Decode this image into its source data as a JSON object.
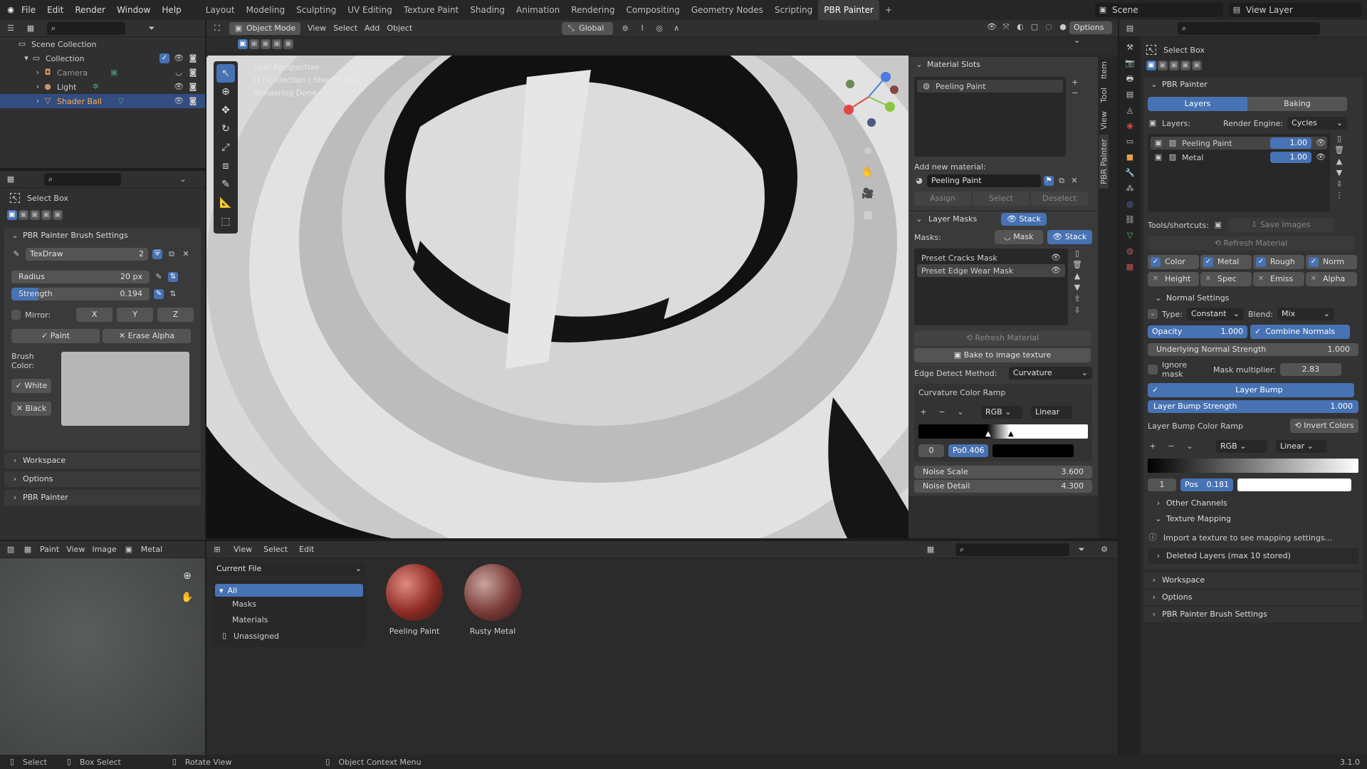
{
  "topmenu": [
    "File",
    "Edit",
    "Render",
    "Window",
    "Help"
  ],
  "workspaces": [
    "Layout",
    "Modeling",
    "Sculpting",
    "UV Editing",
    "Texture Paint",
    "Shading",
    "Animation",
    "Rendering",
    "Compositing",
    "Geometry Nodes",
    "Scripting",
    "PBR Painter"
  ],
  "active_workspace": "PBR Painter",
  "scene_name": "Scene",
  "view_layer": "View Layer",
  "outliner": {
    "root": "Scene Collection",
    "collection": "Collection",
    "items": [
      "Camera",
      "Light",
      "Shader Ball"
    ]
  },
  "left_tool": {
    "title": "Select Box",
    "brush_panel": "PBR Painter Brush Settings",
    "brush_name": "TexDraw",
    "brush_users": "2",
    "radius_label": "Radius",
    "radius_value": "20 px",
    "strength_label": "Strength",
    "strength_value": "0.194",
    "mirror_label": "Mirror:",
    "mirror_axes": [
      "X",
      "Y",
      "Z"
    ],
    "paint_btn": "Paint",
    "erase_btn": "Erase Alpha",
    "brush_color_label": "Brush Color:",
    "white_btn": "White",
    "black_btn": "Black",
    "sections": [
      "Workspace",
      "Options",
      "PBR Painter"
    ]
  },
  "viewport": {
    "mode": "Object Mode",
    "menus": [
      "View",
      "Select",
      "Add",
      "Object"
    ],
    "orientation": "Global",
    "options": "Options",
    "overlay_lines": [
      "User Perspective",
      "(1) Collection | Shader Ball",
      "Rendering Done"
    ]
  },
  "npanel": {
    "tabs": [
      "Item",
      "Tool",
      "View",
      "PBR Painter"
    ],
    "material_slots_title": "Material Slots",
    "slot": "Peeling Paint",
    "add_new_material": "Add new material:",
    "new_material": "Peeling Paint",
    "assign": "Assign",
    "select": "Select",
    "deselect": "Deselect",
    "layer_masks_title": "Layer Masks",
    "stack": "Stack",
    "masks_label": "Masks:",
    "mask_btn": "Mask",
    "masks": [
      "Preset Cracks Mask",
      "Preset Edge Wear Mask"
    ],
    "refresh_material": "Refresh Material",
    "bake": "Bake to image texture",
    "edge_detect_label": "Edge Detect Method:",
    "edge_detect_value": "Curvature",
    "ramp_title": "Curvature Color Ramp",
    "ramp_mode": "RGB",
    "ramp_interp": "Linear",
    "ramp_index": "0",
    "ramp_pos_label": "Po",
    "ramp_pos": "0.406",
    "noise_scale_label": "Noise Scale",
    "noise_scale": "3.600",
    "noise_detail_label": "Noise Detail",
    "noise_detail": "4.300"
  },
  "bottom_left": {
    "mode": "Paint",
    "menus": [
      "View",
      "Image"
    ],
    "image_name": "Metal"
  },
  "asset_browser": {
    "menus": [
      "View",
      "Select",
      "Edit"
    ],
    "library": "Current File",
    "categories": [
      "All",
      "Masks",
      "Materials",
      "Unassigned"
    ],
    "assets": [
      "Peeling Paint",
      "Rusty Metal"
    ]
  },
  "properties": {
    "tool": "Select Box",
    "panel": "PBR Painter",
    "tab_layers": "Layers",
    "tab_baking": "Baking",
    "layers_label": "Layers:",
    "render_engine_label": "Render Engine:",
    "render_engine": "Cycles",
    "layers": [
      {
        "name": "Peeling Paint",
        "value": "1.00"
      },
      {
        "name": "Metal",
        "value": "1.00"
      }
    ],
    "tools_label": "Tools/shortcuts:",
    "save_images": "Save Images",
    "refresh_material": "Refresh Material",
    "channels_on": [
      "Color",
      "Metal",
      "Rough",
      "Norm"
    ],
    "channels_off": [
      "Height",
      "Spec",
      "Emiss",
      "Alpha"
    ],
    "normal_settings": "Normal Settings",
    "type_label": "Type:",
    "type_value": "Constant",
    "blend_label": "Blend:",
    "blend_value": "Mix",
    "opacity_label": "Opacity",
    "opacity": "1.000",
    "combine_normals": "Combine Normals",
    "underlying_label": "Underlying Normal Strength",
    "underlying": "1.000",
    "ignore_mask": "Ignore mask",
    "mask_mult_label": "Mask multiplier:",
    "mask_mult": "2.83",
    "layer_bump": "Layer Bump",
    "bump_strength_label": "Layer Bump Strength",
    "bump_strength": "1.000",
    "bump_ramp": "Layer Bump Color Ramp",
    "invert_colors": "Invert Colors",
    "ramp_mode": "RGB",
    "ramp_interp": "Linear",
    "ramp_index": "1",
    "ramp_pos_label": "Pos",
    "ramp_pos": "0.181",
    "sections": [
      "Other Channels",
      "Texture Mapping"
    ],
    "info": "Import a texture to see mapping settings...",
    "deleted_layers": "Deleted Layers (max 10 stored)",
    "bottom_sections": [
      "Workspace",
      "Options",
      "PBR Painter Brush Settings"
    ]
  },
  "statusbar": {
    "items": [
      "Select",
      "Box Select",
      "Rotate View",
      "Object Context Menu"
    ],
    "version": "3.1.0"
  }
}
